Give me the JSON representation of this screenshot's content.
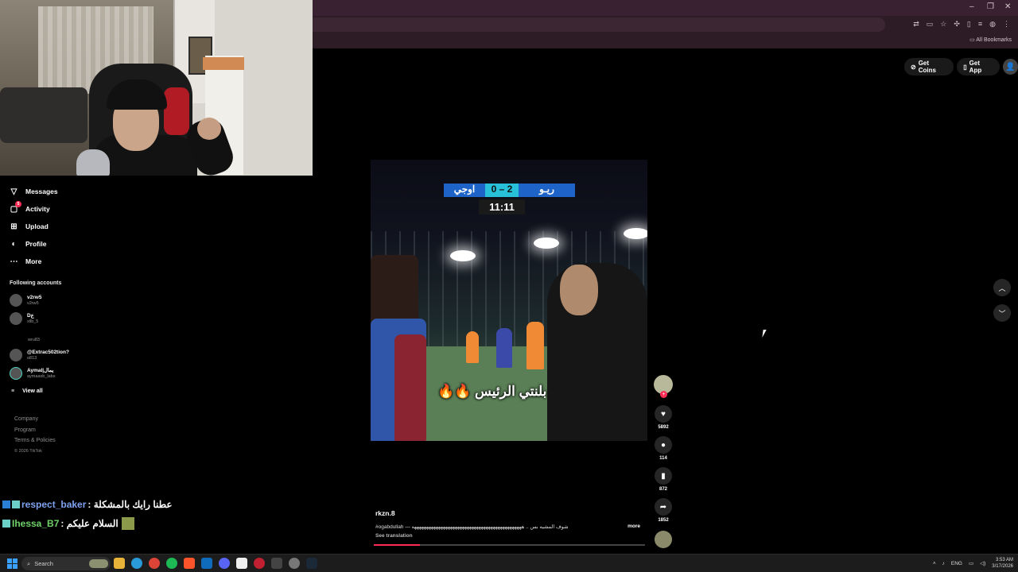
{
  "browser": {
    "bookmarks_label": "All Bookmarks",
    "window_controls": [
      "–",
      "❐",
      "✕"
    ]
  },
  "site_actions": {
    "get_coins": "Get Coins",
    "get_app": "Get App"
  },
  "sidebar": {
    "items": [
      {
        "label": "Messages",
        "icon": "send-icon"
      },
      {
        "label": "Activity",
        "icon": "inbox-icon",
        "badge": "5"
      },
      {
        "label": "Upload",
        "icon": "plus-square-icon"
      },
      {
        "label": "Profile",
        "icon": "user-icon"
      },
      {
        "label": "More",
        "icon": "ellipsis-icon"
      }
    ],
    "following_title": "Following accounts",
    "accounts": [
      {
        "name": "v2rw5",
        "handle": "v2rw5"
      },
      {
        "name": "Dع",
        "handle": "xllb_5"
      },
      {
        "name": "@Extrac502tion?",
        "handle": "o813"
      },
      {
        "name": "Aymal|يمال",
        "handle": "aymaaxb_labs"
      }
    ],
    "orphan_handle": "wru83",
    "view_all": "View all",
    "footer": {
      "company": "Company",
      "program": "Program",
      "terms": "Terms & Policies",
      "copyright": "© 2026 TikTok"
    }
  },
  "video": {
    "scoreboard": {
      "team_left": "اوجي",
      "score": "0 – 2",
      "team_right": "ريـو"
    },
    "clock": "11:11",
    "caption": "بلنتي الرئيس 🔥🔥",
    "author": "rkzn.8",
    "description": "#ogabdullah — شوف المشيه بس .. ههههههههههههههههههههههههههههههههههههههههههههههه",
    "more": "more",
    "see_translation": "See translation",
    "progress": 0.17
  },
  "actions": {
    "likes": "5892",
    "comments": "114",
    "saves": "872",
    "shares": "1852"
  },
  "chat": [
    {
      "user": "respect_baker",
      "message": ": عطنا رايك بالمشكلة"
    },
    {
      "user": "Ihessa_B7",
      "message": ": السلام عليكم"
    }
  ],
  "taskbar": {
    "search": "Search",
    "lang": "ENG",
    "time": "3:53 AM",
    "date": "3/17/2026"
  },
  "colors": {
    "accent": "#fe2c55",
    "chrome": "#3a2131"
  }
}
